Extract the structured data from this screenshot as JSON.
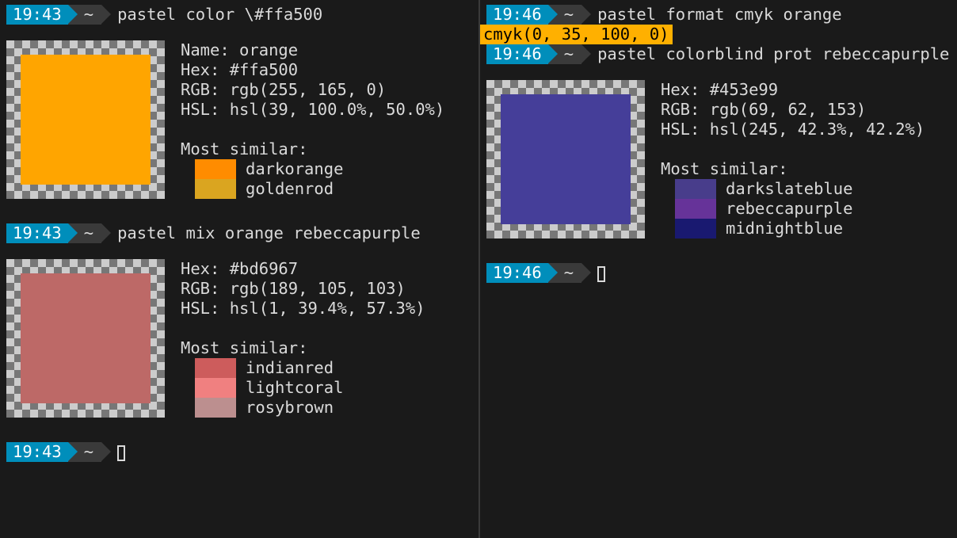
{
  "left": {
    "entries": [
      {
        "time": "19:43",
        "path": "~",
        "cmd": "pastel color \\#ffa500",
        "output": {
          "swatch_color": "#ffa500",
          "lines": [
            "Name: orange",
            "Hex: #ffa500",
            "RGB: rgb(255, 165, 0)",
            "HSL: hsl(39, 100.0%, 50.0%)"
          ],
          "similar_heading": "Most similar:",
          "similar": [
            {
              "name": "darkorange",
              "color": "#ff8c00"
            },
            {
              "name": "goldenrod",
              "color": "#daa520"
            }
          ]
        }
      },
      {
        "time": "19:43",
        "path": "~",
        "cmd": "pastel mix orange rebeccapurple",
        "output": {
          "swatch_color": "#bd6967",
          "lines": [
            "Hex: #bd6967",
            "RGB: rgb(189, 105, 103)",
            "HSL: hsl(1, 39.4%, 57.3%)"
          ],
          "similar_heading": "Most similar:",
          "similar": [
            {
              "name": "indianred",
              "color": "#cd5c5c"
            },
            {
              "name": "lightcoral",
              "color": "#f08080"
            },
            {
              "name": "rosybrown",
              "color": "#bc8f8f"
            }
          ]
        }
      },
      {
        "time": "19:43",
        "path": "~",
        "cursor": true
      }
    ]
  },
  "right": {
    "entries": [
      {
        "time": "19:46",
        "path": "~",
        "cmd": "pastel format cmyk orange",
        "text_output": "cmyk(0, 35, 100, 0)"
      },
      {
        "time": "19:46",
        "path": "~",
        "cmd": "pastel colorblind prot rebeccapurple",
        "output": {
          "swatch_color": "#453e99",
          "lines": [
            "Hex: #453e99",
            "RGB: rgb(69, 62, 153)",
            "HSL: hsl(245, 42.3%, 42.2%)"
          ],
          "similar_heading": "Most similar:",
          "similar": [
            {
              "name": "darkslateblue",
              "color": "#483d8b"
            },
            {
              "name": "rebeccapurple",
              "color": "#663399"
            },
            {
              "name": "midnightblue",
              "color": "#191970"
            }
          ]
        }
      },
      {
        "time": "19:46",
        "path": "~",
        "cursor": true
      }
    ]
  }
}
